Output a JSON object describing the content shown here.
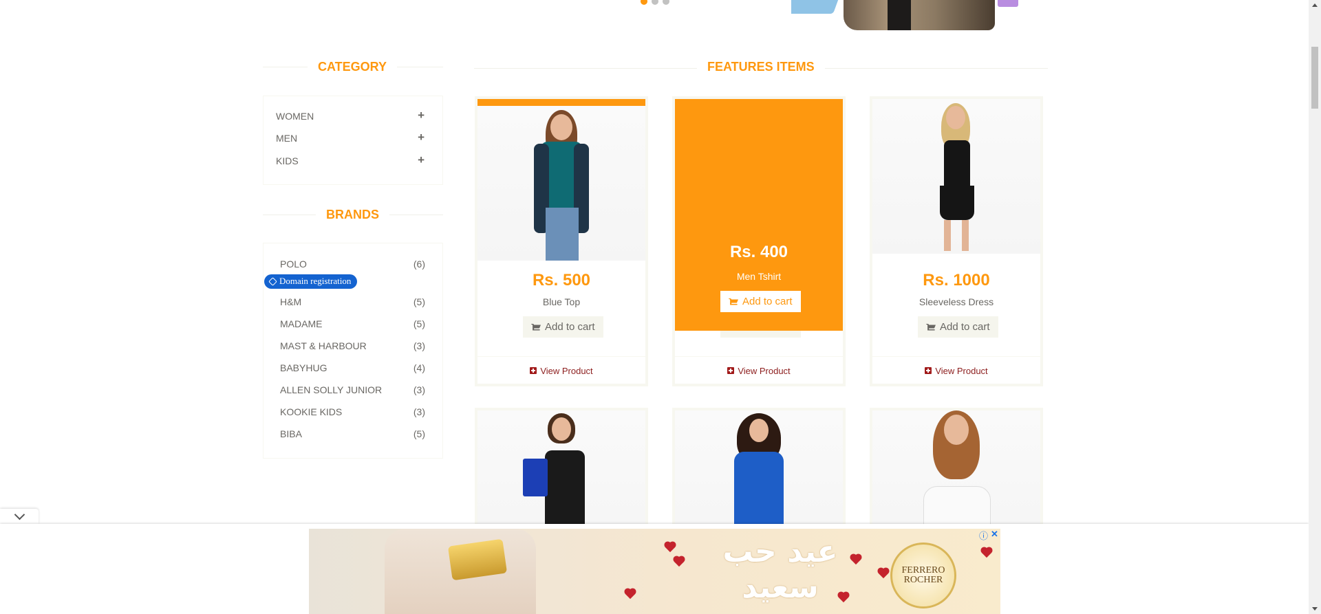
{
  "slider": {
    "dots": [
      true,
      false,
      false
    ]
  },
  "category": {
    "heading": "CATEGORY",
    "items": [
      {
        "label": "WOMEN"
      },
      {
        "label": "MEN"
      },
      {
        "label": "KIDS"
      }
    ],
    "expand_glyph": "+"
  },
  "brands": {
    "heading": "BRANDS",
    "items": [
      {
        "label": "POLO",
        "count": "(6)"
      },
      {
        "label": "H&M",
        "count": "(5)"
      },
      {
        "label": "MADAME",
        "count": "(5)"
      },
      {
        "label": "MAST & HARBOUR",
        "count": "(3)"
      },
      {
        "label": "BABYHUG",
        "count": "(4)"
      },
      {
        "label": "ALLEN SOLLY JUNIOR",
        "count": "(3)"
      },
      {
        "label": "KOOKIE KIDS",
        "count": "(3)"
      },
      {
        "label": "BIBA",
        "count": "(5)"
      }
    ]
  },
  "tag": {
    "label": "Domain registration"
  },
  "features": {
    "heading": "FEATURES ITEMS",
    "products": [
      {
        "price": "Rs. 500",
        "name": "Blue Top",
        "cart": "Add to cart",
        "view": "View Product"
      },
      {
        "price": "Rs. 400",
        "name": "Men Tshirt",
        "cart": "Add to cart",
        "view": "View Product",
        "hovered": true
      },
      {
        "price": "Rs. 1000",
        "name": "Sleeveless Dress",
        "cart": "Add to cart",
        "view": "View Product"
      }
    ]
  },
  "ad": {
    "arabic_text": "عيد حب سعيد",
    "brand": "FERRERO ROCHER",
    "brand_line1": "FERRERO",
    "brand_line2": "ROCHER",
    "info_icon": "ⓘ",
    "close_icon": "✕"
  },
  "colors": {
    "accent": "#FE980F",
    "text": "#696763",
    "link": "#8c1d1d",
    "tag": "#1463d0"
  }
}
